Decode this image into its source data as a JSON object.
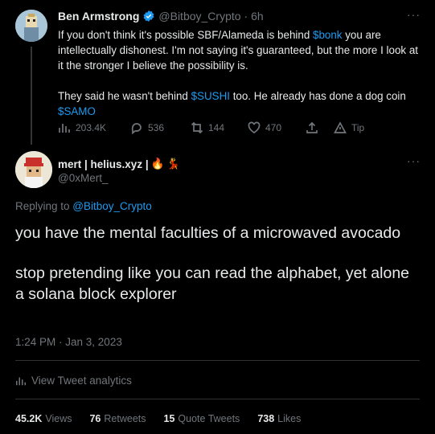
{
  "parent_tweet": {
    "name": "Ben Armstrong",
    "handle": "@Bitboy_Crypto",
    "time": "· 6h",
    "more": "···",
    "line1_before": "If you don't think it's possible SBF/Alameda is behind ",
    "line1_cashtag": "$bonk",
    "line1_after": " you are intellectually dishonest. I'm not saying it's guaranteed, but the more I look at it the stronger I believe the possibility is.",
    "line2_before": "They said he wasn't behind ",
    "line2_cashtag": "$SUSHI",
    "line2_after": " too. He already has done a dog coin ",
    "line2_cashtag2": "$SAMO",
    "actions": {
      "views": "203.4K",
      "replies": "536",
      "retweets": "144",
      "likes": "470",
      "tip": "Tip"
    }
  },
  "reply_tweet": {
    "name": "mert | helius.xyz |",
    "name_emoji": "🔥",
    "name_emoji2": "💃",
    "handle": "@0xMert_",
    "more": "···",
    "replying_prefix": "Replying to ",
    "replying_handle": "@Bitboy_Crypto",
    "text1": "you have the mental faculties of a microwaved avocado",
    "text2": "stop pretending like you can read the alphabet, yet alone a solana block explorer",
    "timestamp": "1:24 PM · Jan 3, 2023",
    "analytics": "View Tweet analytics",
    "stats": {
      "views_count": "45.2K",
      "views_label": "Views",
      "retweets_count": "76",
      "retweets_label": "Retweets",
      "quotes_count": "15",
      "quotes_label": "Quote Tweets",
      "likes_count": "738",
      "likes_label": "Likes"
    }
  },
  "colors": {
    "background": "#000000",
    "accent": "#1d9bf0",
    "muted": "#71767b",
    "text": "#e7e9ea"
  }
}
